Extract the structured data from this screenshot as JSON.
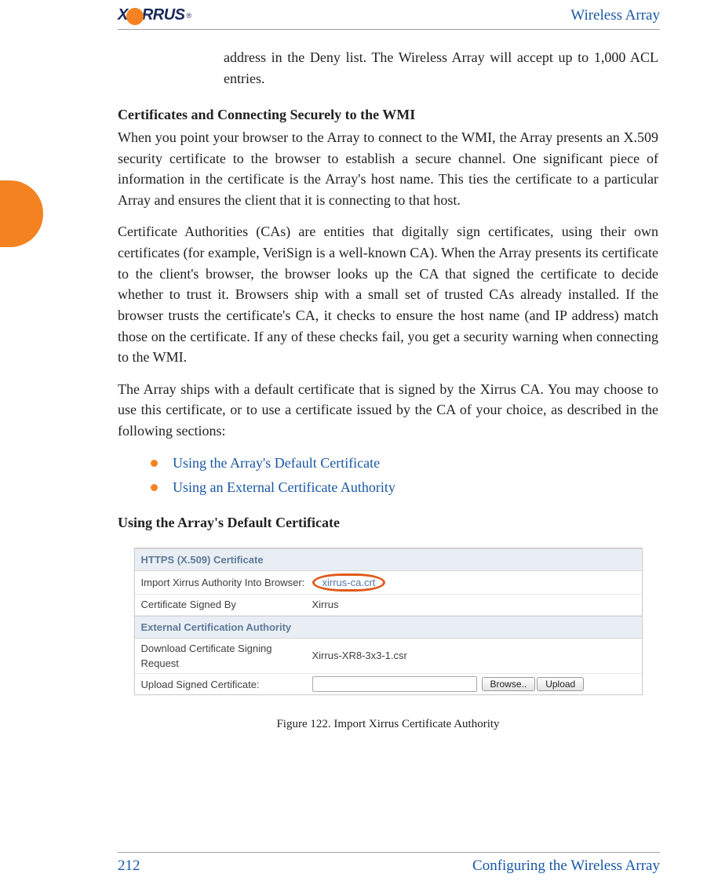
{
  "header": {
    "logo_text_prefix": "X",
    "logo_text_suffix": "RRUS",
    "logo_reg": "®",
    "title": "Wireless Array"
  },
  "content": {
    "intro": "address in the Deny list. The Wireless Array will accept up to 1,000 ACL entries.",
    "section_heading": "Certificates and Connecting Securely to the WMI",
    "para1": "When you point your browser to the Array to connect to the WMI, the Array presents an X.509 security certificate to the browser to establish a secure channel. One significant piece of information in the certificate is the Array's host name. This ties the certificate to a particular Array and ensures the client that it is connecting to that host.",
    "para2": "Certificate Authorities (CAs) are entities that digitally sign certificates, using their own certificates (for example, VeriSign is a well-known CA). When the Array presents its certificate to the client's browser, the browser looks up the CA that signed the certificate to decide whether to trust it. Browsers ship with a small set of trusted CAs already installed. If the browser trusts the certificate's CA, it checks to ensure the host name (and IP address) match those on the certificate. If any of these checks fail, you get a security warning when connecting to the WMI.",
    "para3": "The Array ships with a default certificate that is signed by the Xirrus CA. You may choose to use this certificate, or to use a certificate issued by the CA of your choice, as described in the following sections:",
    "bullets": [
      "Using the Array's Default Certificate",
      "Using an External Certificate Authority"
    ],
    "subhead": "Using the Array's Default Certificate"
  },
  "ui_screenshot": {
    "cat1": "HTTPS (X.509) Certificate",
    "row1_label": "Import Xirrus Authority Into Browser:",
    "row1_value": "xirrus-ca.crt",
    "row2_label": "Certificate Signed By",
    "row2_value": "Xirrus",
    "cat2": "External Certification Authority",
    "row3_label": "Download Certificate Signing Request",
    "row3_value": "Xirrus-XR8-3x3-1.csr",
    "row4_label": "Upload Signed Certificate:",
    "browse_btn": "Browse..",
    "upload_btn": "Upload"
  },
  "figure_caption": "Figure 122. Import Xirrus Certificate Authority",
  "footer": {
    "page_number": "212",
    "title": "Configuring the Wireless Array"
  }
}
